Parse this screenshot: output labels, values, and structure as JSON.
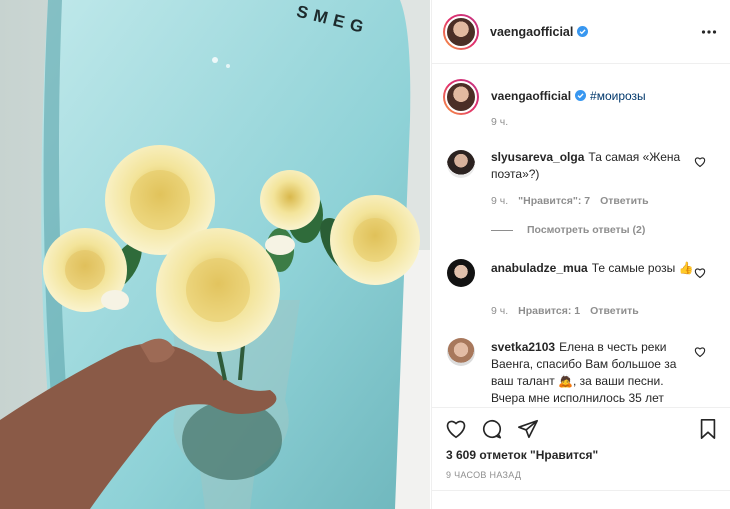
{
  "post": {
    "author": "vaengaofficial",
    "photo_brand_text": "SMEG"
  },
  "caption": {
    "username": "vaengaofficial",
    "hashtag": "#моирозы",
    "time": "9 ч."
  },
  "comments": [
    {
      "username": "slyusareva_olga",
      "text": "Та самая «Жена поэта»?)",
      "time": "9 ч.",
      "likes": "\"Нравится\": 7",
      "reply": "Ответить",
      "view_replies": "Посмотреть ответы (2)"
    },
    {
      "username": "anabuladze_mua",
      "text": "Те самые розы 👍",
      "time": "9 ч.",
      "likes": "Нравится: 1",
      "reply": "Ответить"
    },
    {
      "username": "svetka2103",
      "text": "Елена в честь реки Ваенга, спасибо Вам большое за ваш талант 🙇, за ваши песни. Вчера мне исполнилось 35 лет"
    }
  ],
  "likes_count": "3 609 отметок \"Нравится\"",
  "date": "9 ЧАСОВ НАЗАД",
  "colors": {
    "verified": "#3897f0",
    "link": "#00376b",
    "secondary": "#8e8e8e",
    "ring_start": "#f9a03f",
    "ring_end": "#c13584"
  },
  "icons": [
    "more-options-icon",
    "verified-badge-icon",
    "heart-icon",
    "comment-icon",
    "share-icon",
    "bookmark-icon"
  ]
}
